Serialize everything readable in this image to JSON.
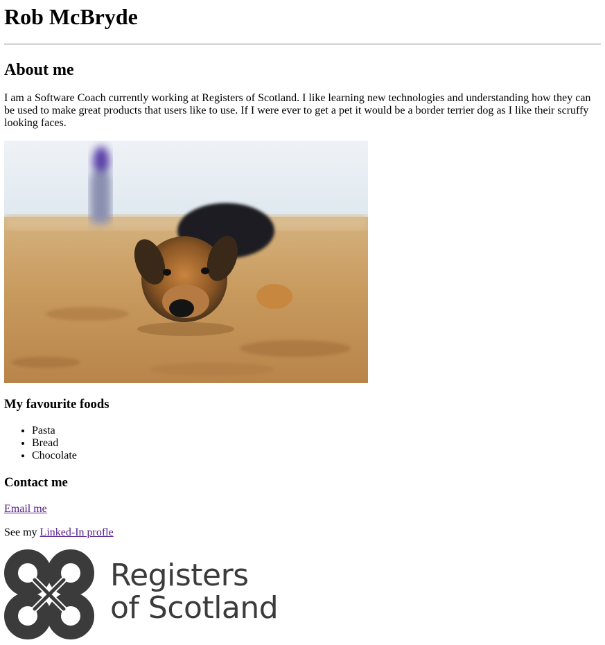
{
  "page": {
    "heading": "Rob McBryde",
    "about": {
      "title": "About me",
      "text": "I am a Software Coach currently working at Registers of Scotland. I like learning new technologies and understanding how they can be used to make great products that users like to use. If I were ever to get a pet it would be a border terrier dog as I like their scruffy looking faces."
    },
    "photo": {
      "icon": "border-terrier-photo"
    },
    "foods": {
      "title": "My favourite foods",
      "items": [
        "Pasta",
        "Bread",
        "Chocolate"
      ]
    },
    "contact": {
      "title": "Contact me",
      "email_link": "Email me",
      "linkedin_prefix": "See my ",
      "linkedin_link": "Linked-In profle"
    },
    "logo": {
      "line1": "Registers",
      "line2": "of Scotland",
      "color": "#3b3b3b"
    }
  }
}
